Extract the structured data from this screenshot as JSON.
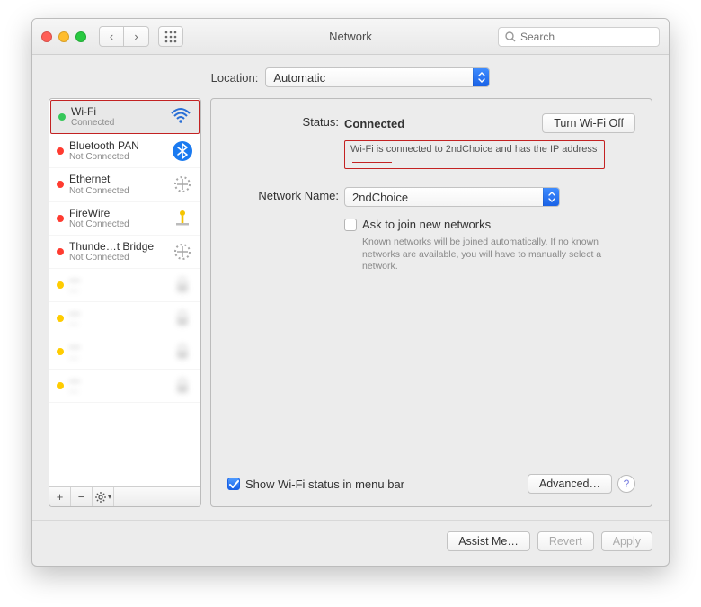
{
  "titlebar": {
    "title": "Network",
    "search_placeholder": "Search"
  },
  "location": {
    "label": "Location:",
    "value": "Automatic"
  },
  "services": [
    {
      "name": "Wi-Fi",
      "status": "Connected",
      "dot": "green",
      "icon": "wifi",
      "selected": true
    },
    {
      "name": "Bluetooth PAN",
      "status": "Not Connected",
      "dot": "red",
      "icon": "bluetooth"
    },
    {
      "name": "Ethernet",
      "status": "Not Connected",
      "dot": "red",
      "icon": "ethernet"
    },
    {
      "name": "FireWire",
      "status": "Not Connected",
      "dot": "red",
      "icon": "firewire"
    },
    {
      "name": "Thunde…t Bridge",
      "status": "Not Connected",
      "dot": "red",
      "icon": "ethernet"
    },
    {
      "name": "—",
      "status": "—",
      "dot": "yellow",
      "icon": "lock",
      "blur": true
    },
    {
      "name": "—",
      "status": "—",
      "dot": "yellow",
      "icon": "lock",
      "blur": true
    },
    {
      "name": "—",
      "status": "—",
      "dot": "yellow",
      "icon": "lock",
      "blur": true
    },
    {
      "name": "—",
      "status": "—",
      "dot": "yellow",
      "icon": "lock",
      "blur": true
    }
  ],
  "details": {
    "status_label": "Status:",
    "status_value": "Connected",
    "wifi_off_btn": "Turn Wi-Fi Off",
    "status_desc": "Wi-Fi is connected to 2ndChoice and has the IP address ",
    "network_label": "Network Name:",
    "network_value": "2ndChoice",
    "ask_label": "Ask to join new networks",
    "ask_help": "Known networks will be joined automatically. If no known networks are available, you will have to manually select a network.",
    "show_status_label": "Show Wi-Fi status in menu bar",
    "advanced_btn": "Advanced…"
  },
  "footer": {
    "assist": "Assist Me…",
    "revert": "Revert",
    "apply": "Apply"
  }
}
